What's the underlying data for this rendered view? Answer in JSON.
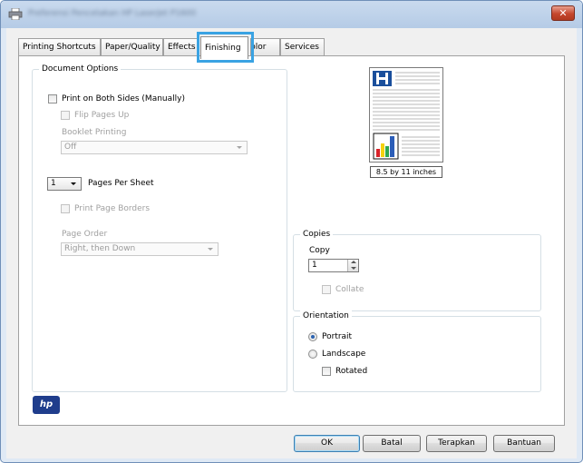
{
  "window": {
    "title": "Preferensi Pencetakan HP LaserJet P1600",
    "close_label": "✕"
  },
  "tabs": [
    {
      "label": "Printing Shortcuts"
    },
    {
      "label": "Paper/Quality"
    },
    {
      "label": "Effects"
    },
    {
      "label": "Finishing"
    },
    {
      "label": "Color"
    },
    {
      "label": "Services"
    }
  ],
  "active_tab": "Finishing",
  "document_options": {
    "title": "Document Options",
    "print_both_sides": {
      "label": "Print on Both Sides (Manually)",
      "checked": false
    },
    "flip_pages_up": {
      "label": "Flip Pages Up",
      "checked": false,
      "enabled": false
    },
    "booklet_printing": {
      "label": "Booklet Printing",
      "value": "Off"
    },
    "pages_per_sheet": {
      "value": "1",
      "label": "Pages Per Sheet"
    },
    "print_page_borders": {
      "label": "Print Page Borders",
      "checked": false,
      "enabled": false
    },
    "page_order": {
      "label": "Page Order",
      "value": "Right, then Down"
    }
  },
  "preview": {
    "size_label": "8.5 by 11 inches",
    "colors": {
      "letter": "#1a4f9c",
      "bar_red": "#d8232a",
      "bar_yellow": "#f5d20e",
      "bar_green": "#2fa84f",
      "bar_blue": "#2b5db8"
    }
  },
  "copies": {
    "title": "Copies",
    "copy_label": "Copy",
    "copy_value": "1",
    "collate": {
      "label": "Collate",
      "checked": false,
      "enabled": false
    }
  },
  "orientation": {
    "title": "Orientation",
    "portrait": {
      "label": "Portrait",
      "selected": true
    },
    "landscape": {
      "label": "Landscape",
      "selected": false
    },
    "rotated": {
      "label": "Rotated",
      "checked": false
    }
  },
  "logo": {
    "text": "hp"
  },
  "buttons": {
    "ok": "OK",
    "cancel": "Batal",
    "apply": "Terapkan",
    "help": "Bantuan"
  }
}
